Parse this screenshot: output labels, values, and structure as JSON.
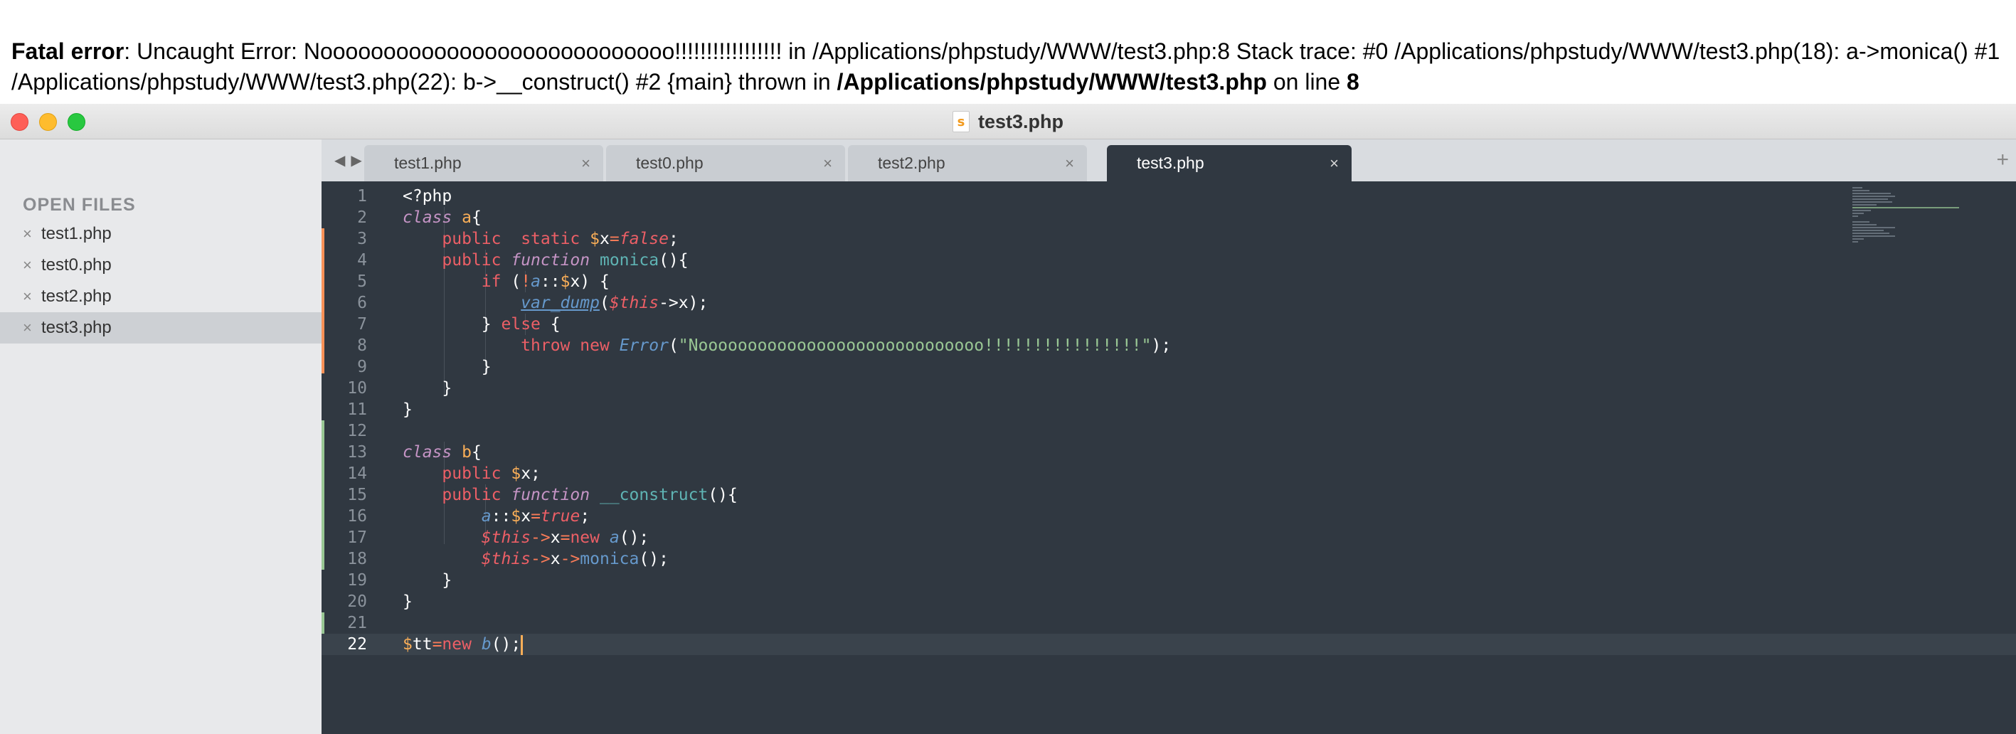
{
  "error": {
    "label": "Fatal error",
    "message": ": Uncaught Error: Noooooooooooooooooooooooooooo!!!!!!!!!!!!!!!!! in /Applications/phpstudy/WWW/test3.php:8 Stack trace: #0 /Applications/phpstudy/WWW/test3.php(18): a->monica() #1 /Applications/phpstudy/WWW/test3.php(22): b->__construct() #2 {main} thrown in ",
    "file": "/Applications/phpstudy/WWW/test3.php",
    "on_line_text": " on line ",
    "line": "8"
  },
  "window": {
    "title": "test3.php",
    "file_icon_glyph": "s"
  },
  "sidebar": {
    "heading": "OPEN FILES",
    "close_glyph": "×",
    "items": [
      {
        "name": "test1.php"
      },
      {
        "name": "test0.php"
      },
      {
        "name": "test2.php"
      },
      {
        "name": "test3.php",
        "active": true
      }
    ]
  },
  "tabs": {
    "nav_prev": "◀",
    "nav_next": "▶",
    "close_glyph": "×",
    "add_glyph": "+",
    "items": [
      {
        "label": "test1.php"
      },
      {
        "label": "test0.php"
      },
      {
        "label": "test2.php"
      },
      {
        "label": "test3.php",
        "active": true
      }
    ]
  },
  "editor": {
    "line_numbers": [
      "1",
      "2",
      "3",
      "4",
      "5",
      "6",
      "7",
      "8",
      "9",
      "10",
      "11",
      "12",
      "13",
      "14",
      "15",
      "16",
      "17",
      "18",
      "19",
      "20",
      "21",
      "22"
    ],
    "current_line": 22,
    "colors": {
      "background": "#303841",
      "keyword": "#ec5f66",
      "string": "#99c794",
      "function": "#5fb4b4",
      "variable": "#f9ae58",
      "call": "#6699cc"
    }
  }
}
